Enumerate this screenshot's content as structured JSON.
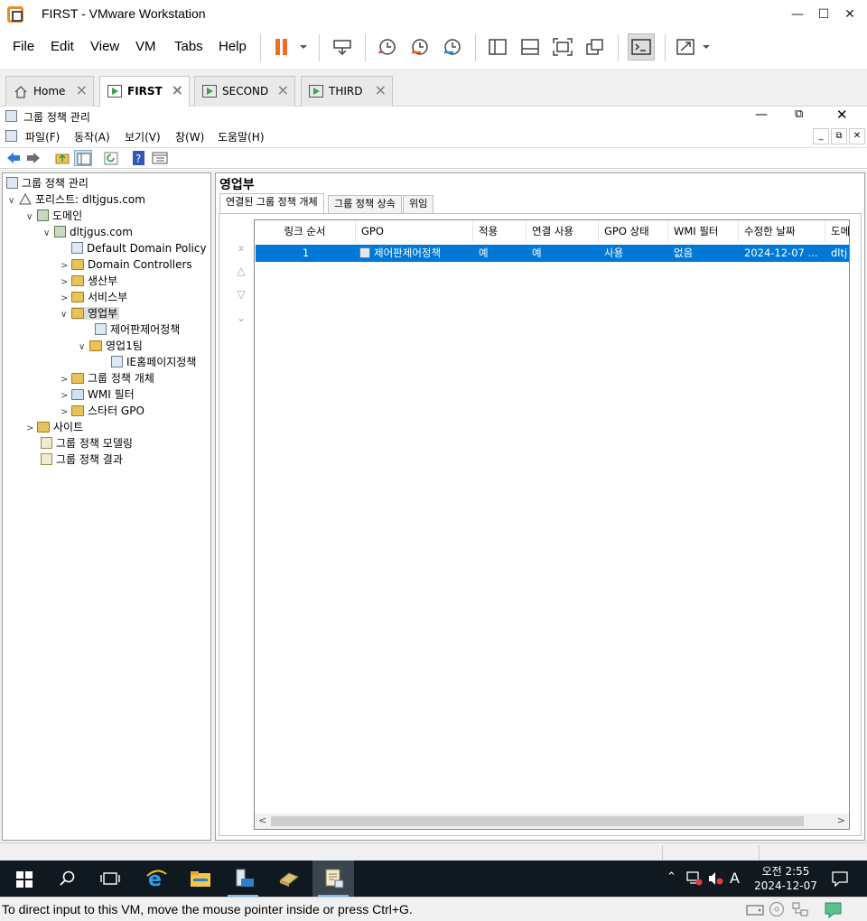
{
  "vmware": {
    "title": "FIRST - VMware Workstation",
    "menu": [
      "File",
      "Edit",
      "View",
      "VM",
      "Tabs",
      "Help"
    ],
    "tabs": [
      {
        "label": "Home",
        "active": false
      },
      {
        "label": "FIRST",
        "active": true
      },
      {
        "label": "SECOND",
        "active": false
      },
      {
        "label": "THIRD",
        "active": false
      }
    ],
    "status_message": "To direct input to this VM, move the mouse pointer inside or press Ctrl+G."
  },
  "mmc": {
    "title": "그룹 정책 관리",
    "menu": [
      "파일(F)",
      "동작(A)",
      "보기(V)",
      "창(W)",
      "도움말(H)"
    ],
    "tree": [
      {
        "label": "그룹 정책 관리",
        "expander": ""
      },
      {
        "label": "포리스트: dltjgus.com",
        "expander": "v"
      },
      {
        "label": "도메인",
        "expander": "v"
      },
      {
        "label": "dltjgus.com",
        "expander": "v"
      },
      {
        "label": "Default Domain Policy",
        "expander": ""
      },
      {
        "label": "Domain Controllers",
        "expander": ">"
      },
      {
        "label": "생산부",
        "expander": ">"
      },
      {
        "label": "서비스부",
        "expander": ">"
      },
      {
        "label": "영업부",
        "expander": "v"
      },
      {
        "label": "제어판제어정책",
        "expander": ""
      },
      {
        "label": "영업1팀",
        "expander": "v"
      },
      {
        "label": "IE홈페이지정책",
        "expander": ""
      },
      {
        "label": "그룹 정책 개체",
        "expander": ">"
      },
      {
        "label": "WMI 필터",
        "expander": ">"
      },
      {
        "label": "스타터 GPO",
        "expander": ">"
      },
      {
        "label": "사이트",
        "expander": ">"
      },
      {
        "label": "그룹 정책 모델링",
        "expander": ""
      },
      {
        "label": "그룹 정책 결과",
        "expander": ""
      }
    ],
    "right_title": "영업부",
    "right_tabs": [
      "연결된 그룹 정책 개체",
      "그룹 정책 상속",
      "위임"
    ],
    "columns": [
      "링크 순서",
      "GPO",
      "적용",
      "연결 사용",
      "GPO 상태",
      "WMI 필터",
      "수정한 날짜",
      "도메"
    ],
    "rows": [
      [
        "1",
        "제어판제어정책",
        "예",
        "예",
        "사용",
        "없음",
        "2024-12-07 ...",
        "dltj"
      ]
    ]
  },
  "taskbar": {
    "time": "오전 2:55",
    "date": "2024-12-07",
    "ime": "A"
  }
}
